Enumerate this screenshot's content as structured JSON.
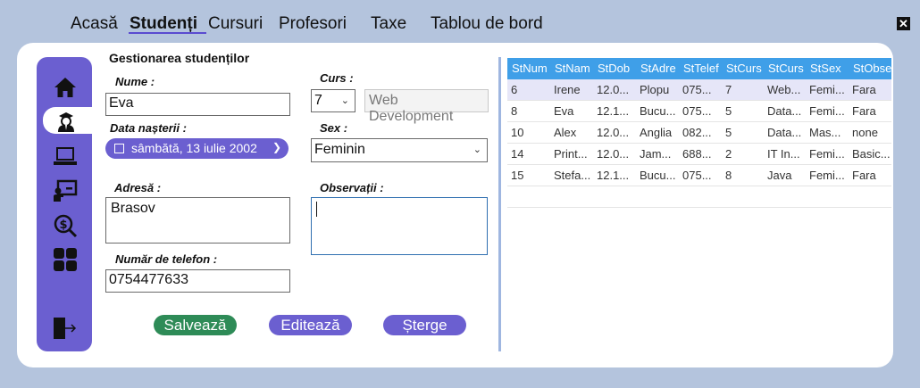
{
  "nav": {
    "items": [
      "Acasă",
      "Studenți",
      "Cursuri",
      "Profesori",
      "Taxe",
      "Tablou de bord"
    ],
    "active": "Studenți"
  },
  "window": {
    "close_label": "✕"
  },
  "sidebar": {
    "icons": [
      "home-icon",
      "student-icon",
      "laptop-icon",
      "teacher-icon",
      "fees-icon",
      "dashboard-icon",
      "logout-icon"
    ]
  },
  "form": {
    "title": "Gestionarea studenților",
    "name_label": "Nume :",
    "name_value": "Eva",
    "birth_label": "Data nașterii :",
    "birth_value": "sâmbătă, 13 iulie 2002",
    "address_label": "Adresă :",
    "address_value": "Brasov",
    "phone_label": "Număr de telefon :",
    "phone_value": "0754477633",
    "course_label": "Curs :",
    "course_value": "7",
    "course_name": "Web Development",
    "sex_label": "Sex :",
    "sex_value": "Feminin",
    "obs_label": "Observații :",
    "obs_value": ""
  },
  "buttons": {
    "save": "Salvează",
    "edit": "Editează",
    "delete": "Șterge"
  },
  "colors": {
    "accent": "#6b5fd0",
    "save": "#2e8b57",
    "grid_header": "#3f9fe8"
  },
  "grid": {
    "columns": [
      "StNum",
      "StNam",
      "StDob",
      "StAdre",
      "StTelef",
      "StCurs",
      "StCurs",
      "StSex",
      "StObse"
    ],
    "rows": [
      [
        "6",
        "Irene",
        "12.0...",
        "Plopu",
        "075...",
        "7",
        "Web...",
        "Femi...",
        "Fara"
      ],
      [
        "8",
        "Eva",
        "12.1...",
        "Bucu...",
        "075...",
        "5",
        "Data...",
        "Femi...",
        "Fara"
      ],
      [
        "10",
        "Alex",
        "12.0...",
        "Anglia",
        "082...",
        "5",
        "Data...",
        "Mas...",
        "none"
      ],
      [
        "14",
        "Print...",
        "12.0...",
        "Jam...",
        "688...",
        "2",
        "IT In...",
        "Femi...",
        "Basic..."
      ],
      [
        "15",
        "Stefa...",
        "12.1...",
        "Bucu...",
        "075...",
        "8",
        "Java",
        "Femi...",
        "Fara"
      ]
    ],
    "selected_row": 0
  }
}
